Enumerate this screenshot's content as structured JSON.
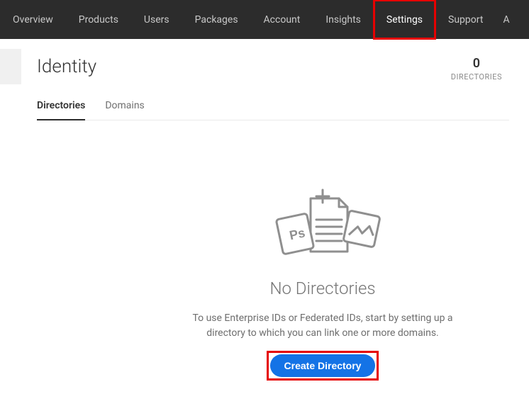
{
  "nav": {
    "items": [
      {
        "label": "Overview",
        "active": false
      },
      {
        "label": "Products",
        "active": false
      },
      {
        "label": "Users",
        "active": false
      },
      {
        "label": "Packages",
        "active": false
      },
      {
        "label": "Account",
        "active": false
      },
      {
        "label": "Insights",
        "active": false
      },
      {
        "label": "Settings",
        "active": true,
        "highlight": true
      },
      {
        "label": "Support",
        "active": false
      }
    ],
    "overflow": "A"
  },
  "page": {
    "title": "Identity",
    "count_number": "0",
    "count_label": "DIRECTORIES"
  },
  "subtabs": [
    {
      "label": "Directories",
      "active": true
    },
    {
      "label": "Domains",
      "active": false
    }
  ],
  "empty_state": {
    "title": "No Directories",
    "description": "To use Enterprise IDs or Federated IDs, start by setting up a directory to which you can link one or more domains.",
    "button_label": "Create Directory"
  },
  "icons": {
    "ps": "Ps"
  }
}
